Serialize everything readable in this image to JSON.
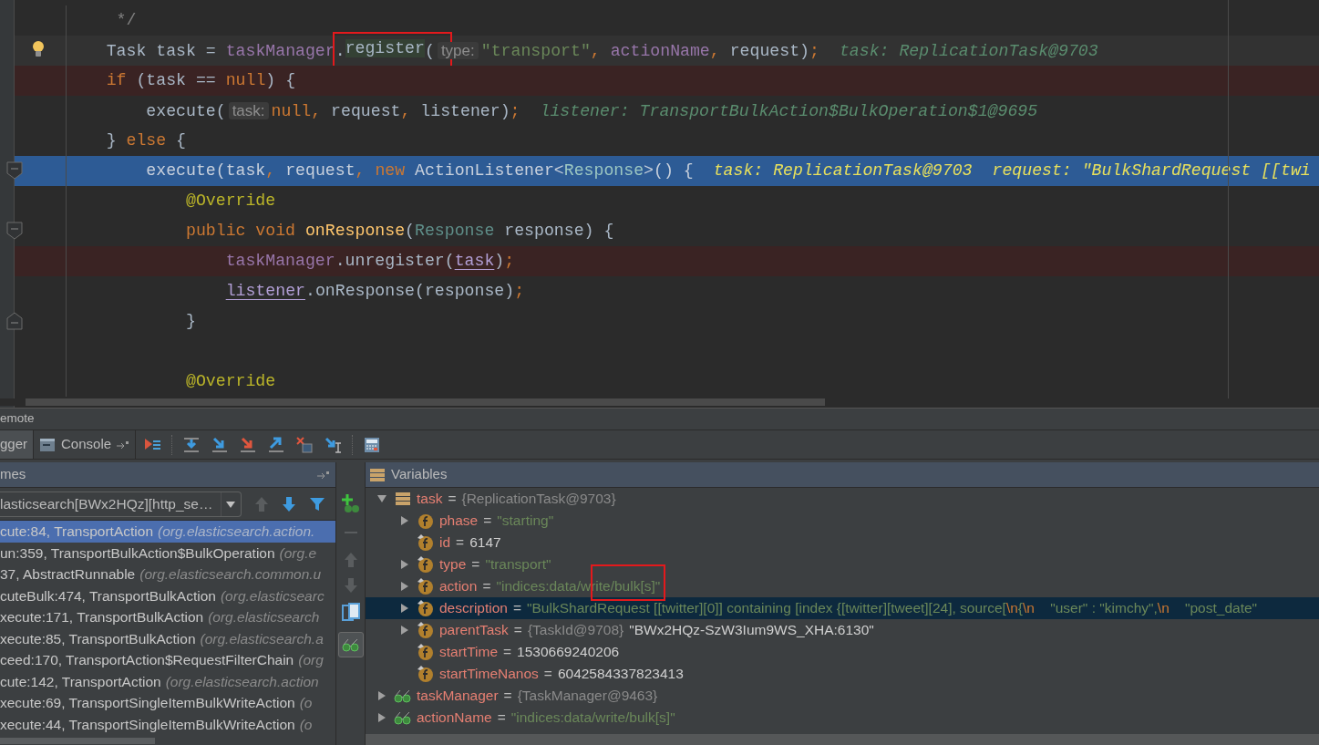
{
  "editor": {
    "lines": [
      {
        "tokens": [
          {
            "text": "     */",
            "kind": "comment"
          }
        ]
      },
      {
        "highlight": {
          "kind": "caret"
        },
        "gutter": {
          "kind": "bulb"
        },
        "tokens": [
          {
            "text": "    Task task = ",
            "kind": "plain"
          },
          {
            "text": "taskManager",
            "kind": "field"
          },
          {
            "text": ".",
            "kind": "plain"
          },
          {
            "text": "register",
            "kind": "boxed"
          },
          {
            "text": "(",
            "kind": "plain"
          },
          {
            "text": "type:",
            "kind": "param_hint"
          },
          {
            "text": "\"transport\"",
            "kind": "string"
          },
          {
            "text": ", ",
            "kind": "keyword"
          },
          {
            "text": "actionName",
            "kind": "field"
          },
          {
            "text": ", ",
            "kind": "keyword"
          },
          {
            "text": "request)",
            "kind": "plain"
          },
          {
            "text": ";",
            "kind": "keyword"
          },
          {
            "text": "task: ReplicationTask@9703",
            "kind": "debug_value"
          }
        ]
      },
      {
        "highlight": {
          "kind": "breakpoint"
        },
        "tokens": [
          {
            "text": "    if",
            "kind": "keyword"
          },
          {
            "text": " (task == ",
            "kind": "plain"
          },
          {
            "text": "null",
            "kind": "keyword"
          },
          {
            "text": ") {",
            "kind": "plain"
          }
        ]
      },
      {
        "tokens": [
          {
            "text": "        execute(",
            "kind": "plain"
          },
          {
            "text": "task:",
            "kind": "param_hint"
          },
          {
            "text": "null",
            "kind": "keyword"
          },
          {
            "text": ", ",
            "kind": "keyword"
          },
          {
            "text": "request",
            "kind": "plain"
          },
          {
            "text": ", ",
            "kind": "keyword"
          },
          {
            "text": "listener)",
            "kind": "plain"
          },
          {
            "text": ";",
            "kind": "keyword"
          },
          {
            "text": "listener: TransportBulkAction$BulkOperation$1@9695",
            "kind": "debug_value"
          }
        ]
      },
      {
        "tokens": [
          {
            "text": "    } ",
            "kind": "plain"
          },
          {
            "text": "else",
            "kind": "keyword"
          },
          {
            "text": " {",
            "kind": "plain"
          }
        ]
      },
      {
        "highlight": {
          "kind": "execution"
        },
        "gutter": {
          "kind": "fold_start"
        },
        "tokens": [
          {
            "text": "        execute(task",
            "kind": "plain"
          },
          {
            "text": ", ",
            "kind": "keyword"
          },
          {
            "text": "request",
            "kind": "plain"
          },
          {
            "text": ", ",
            "kind": "keyword"
          },
          {
            "text": "new ",
            "kind": "keyword"
          },
          {
            "text": "ActionListener<",
            "kind": "plain"
          },
          {
            "text": "Response",
            "kind": "type_param"
          },
          {
            "text": ">() {",
            "kind": "plain"
          },
          {
            "text": "task: ReplicationTask@9703",
            "kind": "debug_value"
          },
          {
            "text": "request: \"BulkShardRequest [[twi",
            "kind": "debug_value"
          }
        ]
      },
      {
        "tokens": [
          {
            "text": "            @Override",
            "kind": "annotation"
          }
        ]
      },
      {
        "gutter": {
          "kind": "fold_start"
        },
        "tokens": [
          {
            "text": "            public void ",
            "kind": "keyword"
          },
          {
            "text": "onResponse",
            "kind": "method_decl"
          },
          {
            "text": "(",
            "kind": "plain"
          },
          {
            "text": "Response",
            "kind": "type_param"
          },
          {
            "text": " response) {",
            "kind": "plain"
          }
        ]
      },
      {
        "highlight": {
          "kind": "breakpoint"
        },
        "tokens": [
          {
            "text": "                taskManager",
            "kind": "field"
          },
          {
            "text": ".unregister(",
            "kind": "plain"
          },
          {
            "text": "task",
            "kind": "captured"
          },
          {
            "text": ")",
            "kind": "plain"
          },
          {
            "text": ";",
            "kind": "keyword"
          }
        ]
      },
      {
        "tokens": [
          {
            "text": "                listener",
            "kind": "captured"
          },
          {
            "text": ".onResponse(response)",
            "kind": "plain"
          },
          {
            "text": ";",
            "kind": "keyword"
          }
        ]
      },
      {
        "gutter": {
          "kind": "fold_end"
        },
        "tokens": [
          {
            "text": "            }",
            "kind": "plain"
          }
        ]
      },
      {
        "tokens": [
          {
            "text": "            @Override",
            "kind": "annotation"
          }
        ]
      }
    ]
  },
  "debug_panel": {
    "title": "emote",
    "tabs": [
      {
        "label": "gger",
        "kind": "debugger",
        "selected": true
      },
      {
        "label": "Console",
        "kind": "console",
        "selected": false
      }
    ],
    "frames": {
      "header": "mes",
      "thread": "lasticsearch[BWx2HQz][http_se…",
      "items": [
        {
          "method": "cute:84, TransportAction",
          "location": "(org.elasticsearch.action.",
          "selected": true
        },
        {
          "method": "un:359, TransportBulkAction$BulkOperation",
          "location": "(org.e",
          "selected": false
        },
        {
          "method": "37, AbstractRunnable",
          "location": "(org.elasticsearch.common.u",
          "selected": false
        },
        {
          "method": "cuteBulk:474, TransportBulkAction",
          "location": "(org.elasticsearc",
          "selected": false
        },
        {
          "method": "xecute:171, TransportBulkAction",
          "location": "(org.elasticsearch",
          "selected": false
        },
        {
          "method": "xecute:85, TransportBulkAction",
          "location": "(org.elasticsearch.a",
          "selected": false
        },
        {
          "method": "ceed:170, TransportAction$RequestFilterChain",
          "location": "(org",
          "selected": false
        },
        {
          "method": "cute:142, TransportAction",
          "location": "(org.elasticsearch.action",
          "selected": false
        },
        {
          "method": "xecute:69, TransportSingleItemBulkWriteAction",
          "location": "(o",
          "selected": false
        },
        {
          "method": "xecute:44, TransportSingleItemBulkWriteAction",
          "location": "(o",
          "selected": false
        }
      ]
    },
    "variables": {
      "header": "Variables",
      "items": [
        {
          "name": "task",
          "kind": "object",
          "expandable": true,
          "expanded": true,
          "selected": false,
          "highlighted": false,
          "value": [
            {
              "text": "=",
              "kind": "operator"
            },
            {
              "text": "{ReplicationTask@9703}",
              "kind": "type"
            }
          ],
          "children": [
            {
              "name": "phase",
              "kind": "field",
              "expandable": true,
              "expanded": false,
              "selected": false,
              "highlighted": false,
              "value": [
                {
                  "text": "=",
                  "kind": "operator"
                },
                {
                  "text": "\"starting\"",
                  "kind": "string"
                }
              ]
            },
            {
              "name": "id",
              "kind": "final_field",
              "expandable": false,
              "selected": false,
              "highlighted": false,
              "value": [
                {
                  "text": "=",
                  "kind": "operator"
                },
                {
                  "text": "6147",
                  "kind": "number"
                }
              ]
            },
            {
              "name": "type",
              "kind": "final_field",
              "expandable": true,
              "expanded": false,
              "selected": false,
              "highlighted": false,
              "value": [
                {
                  "text": "=",
                  "kind": "operator"
                },
                {
                  "text": "\"transport\"",
                  "kind": "string"
                }
              ]
            },
            {
              "name": "action",
              "kind": "final_field",
              "expandable": true,
              "expanded": false,
              "selected": false,
              "highlighted": true,
              "value": [
                {
                  "text": "=",
                  "kind": "operator"
                },
                {
                  "text": "\"indices:data/write/bulk[s]\"",
                  "kind": "string"
                }
              ]
            },
            {
              "name": "description",
              "kind": "final_field",
              "expandable": true,
              "expanded": false,
              "selected": true,
              "highlighted": false,
              "value": [
                {
                  "text": "=",
                  "kind": "operator"
                },
                {
                  "text": "\"BulkShardRequest [[twitter][0]] containing [index {[twitter][tweet][24], source[",
                  "kind": "string"
                },
                {
                  "text": "\\n",
                  "kind": "escape"
                },
                {
                  "text": "{",
                  "kind": "string"
                },
                {
                  "text": "\\n",
                  "kind": "escape"
                },
                {
                  "text": "    \"user\" : \"kimchy\",",
                  "kind": "string"
                },
                {
                  "text": "\\n",
                  "kind": "escape"
                },
                {
                  "text": "    \"post_date\"",
                  "kind": "string"
                }
              ]
            },
            {
              "name": "parentTask",
              "kind": "final_field",
              "expandable": true,
              "expanded": false,
              "selected": false,
              "highlighted": false,
              "value": [
                {
                  "text": "=",
                  "kind": "operator"
                },
                {
                  "text": "{TaskId@9708}",
                  "kind": "type"
                },
                {
                  "text": "\"BWx2HQz-SzW3Ium9WS_XHA:6130\"",
                  "kind": "number"
                }
              ]
            },
            {
              "name": "startTime",
              "kind": "final_field",
              "expandable": false,
              "selected": false,
              "highlighted": false,
              "value": [
                {
                  "text": "=",
                  "kind": "operator"
                },
                {
                  "text": "1530669240206",
                  "kind": "number"
                }
              ]
            },
            {
              "name": "startTimeNanos",
              "kind": "final_field",
              "expandable": false,
              "selected": false,
              "highlighted": false,
              "value": [
                {
                  "text": "=",
                  "kind": "operator"
                },
                {
                  "text": "6042584337823413",
                  "kind": "number"
                }
              ]
            }
          ]
        },
        {
          "name": "taskManager",
          "kind": "watch",
          "expandable": true,
          "expanded": false,
          "selected": false,
          "highlighted": false,
          "value": [
            {
              "text": "=",
              "kind": "operator"
            },
            {
              "text": "{TaskManager@9463}",
              "kind": "type"
            }
          ]
        },
        {
          "name": "actionName",
          "kind": "watch",
          "expandable": true,
          "expanded": false,
          "selected": false,
          "highlighted": false,
          "value": [
            {
              "text": "=",
              "kind": "operator"
            },
            {
              "text": "\"indices:data/write/bulk[s]\"",
              "kind": "string"
            }
          ]
        }
      ]
    }
  }
}
